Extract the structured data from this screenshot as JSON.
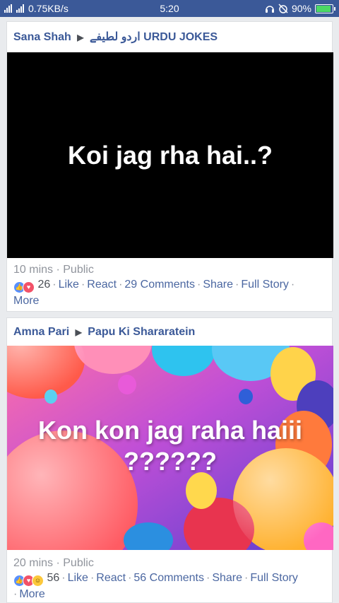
{
  "status_bar": {
    "network_speed": "0.75KB/s",
    "time": "5:20",
    "battery_percent": "90%",
    "battery_level": 0.9
  },
  "posts": [
    {
      "author": "Sana Shah",
      "group_urdu": "اردو لطیفے",
      "group": "URDU JOKES",
      "image_text": "Koi jag rha hai..?",
      "time": "10 mins",
      "privacy": "Public",
      "reaction_count": "26",
      "like_label": "Like",
      "react_label": "React",
      "comments_label": "29 Comments",
      "share_label": "Share",
      "full_story_label": "Full Story",
      "more_label": "More"
    },
    {
      "author": "Amna Pari",
      "group": "Papu Ki Shararatein",
      "image_text_line1": "Kon kon jag raha haiii",
      "image_text_line2": "??????",
      "time": "20 mins",
      "privacy": "Public",
      "reaction_count": "56",
      "like_label": "Like",
      "react_label": "React",
      "comments_label": "56 Comments",
      "share_label": "Share",
      "full_story_label": "Full Story",
      "more_label": "More"
    }
  ],
  "colors": {
    "brand": "#3b5998",
    "link": "#4b67a1",
    "meta": "#90949c",
    "background": "#e9ebee"
  }
}
